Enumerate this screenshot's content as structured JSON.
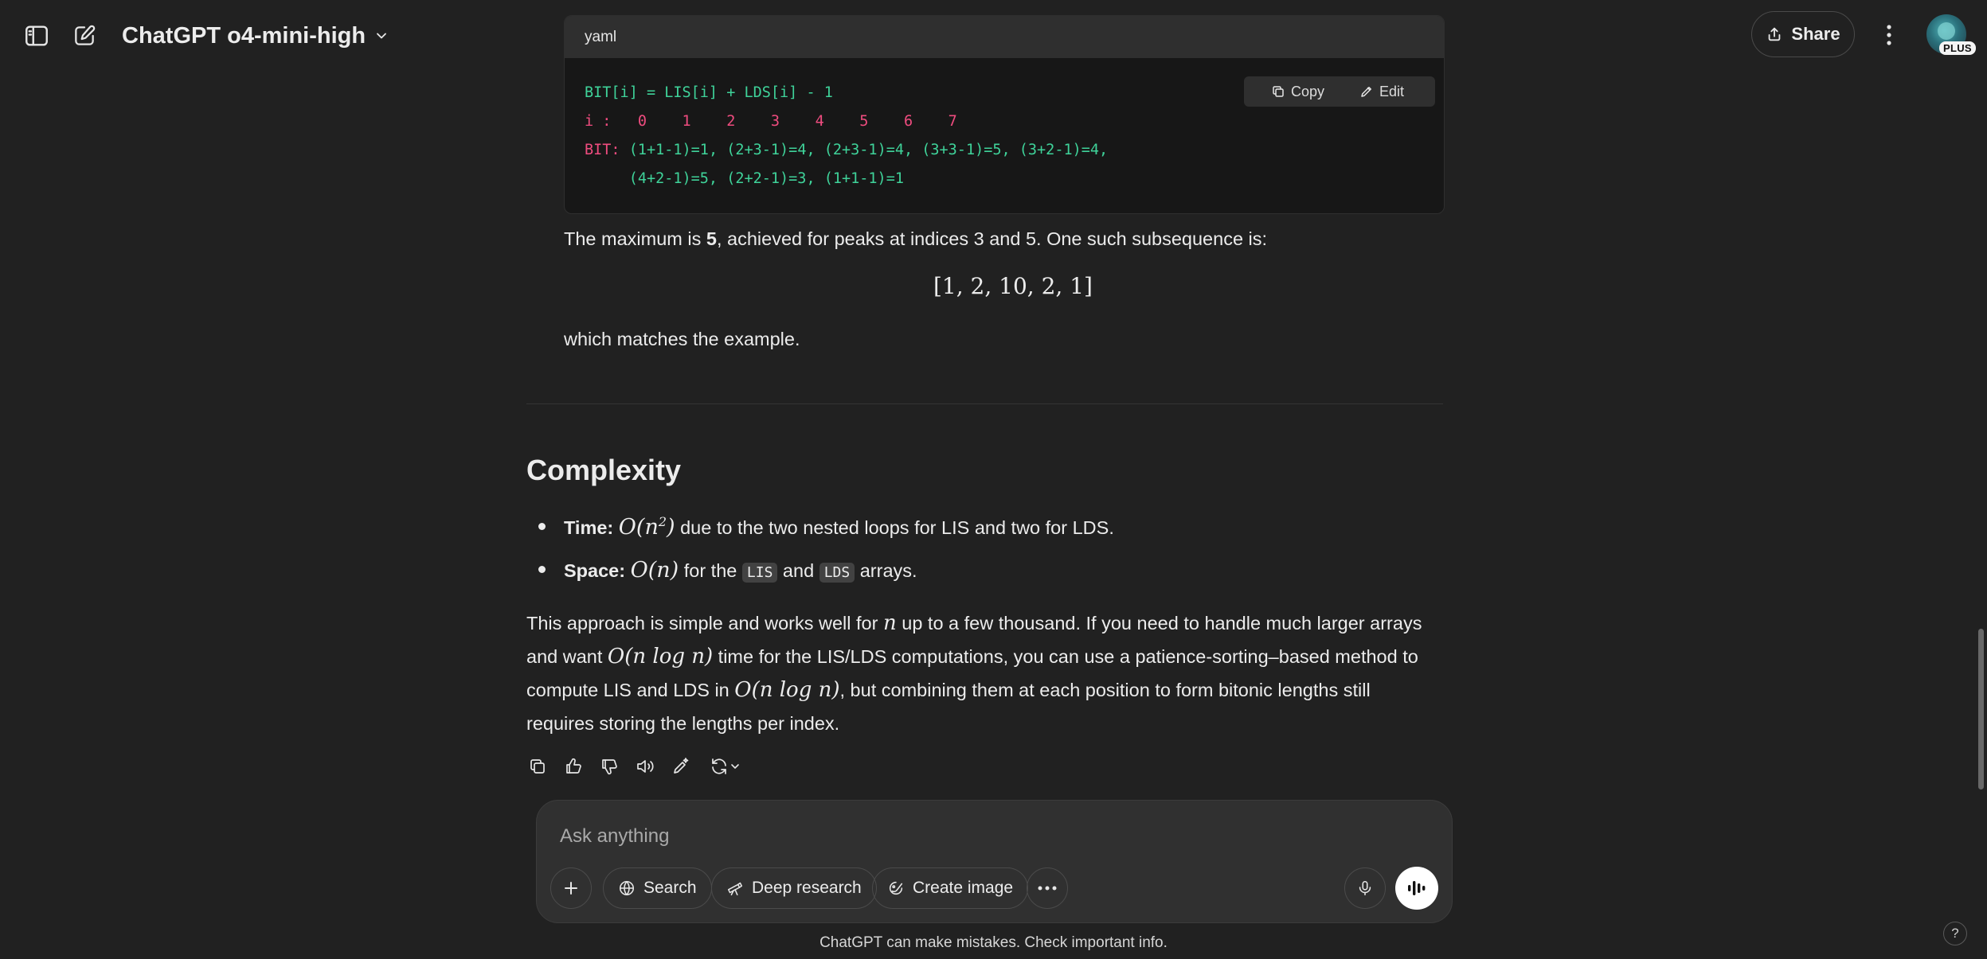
{
  "header": {
    "model_title": "ChatGPT o4-mini-high",
    "share_label": "Share",
    "plan_badge": "PLUS"
  },
  "code_block": {
    "language": "yaml",
    "copy_label": "Copy",
    "edit_label": "Edit",
    "line1": "BIT[i] = LIS[i] + LDS[i] - 1",
    "line2_key": "i :",
    "line2_vals": "   0    1    2    3    4    5    6    7",
    "line3_key": "BIT:",
    "line3_vals": " (1+1-1)=1, (2+3-1)=4, (2+3-1)=4, (3+3-1)=5, (3+2-1)=4,",
    "line4_vals": "     (4+2-1)=5, (2+2-1)=3, (1+1-1)=1"
  },
  "result": {
    "max_prefix": "The maximum is ",
    "max_value": "5",
    "max_suffix": ", achieved for peaks at indices 3 and 5. One such subsequence is:",
    "subsequence_display": "[1, 2, 10, 2, 1]",
    "closing": "which matches the example."
  },
  "complexity": {
    "heading": "Complexity",
    "time_label": "Time:",
    "time_formula_pre": "O(n",
    "time_formula_exp": "2",
    "time_formula_post": ")",
    "time_text": " due to the two nested loops for LIS and two for LDS.",
    "space_label": "Space:",
    "space_formula": "O(n)",
    "space_text1": " for the ",
    "space_code1": "LIS",
    "space_text2": " and ",
    "space_code2": "LDS",
    "space_text3": " arrays."
  },
  "paragraph": {
    "l1_a": "This approach is simple and works well for ",
    "l1_var": "n",
    "l1_b": " up to a few thousand. If you need to handle much larger arrays",
    "l2_a": "and want ",
    "l2_formula": "O(n log n)",
    "l2_b": " time for the LIS/LDS computations, you can use a patience-sorting–based method to",
    "l3_a": "compute LIS and LDS in ",
    "l3_formula": "O(n log n)",
    "l3_b": ", but combining them at each position to form bitonic lengths still",
    "l4": "requires storing the lengths per index."
  },
  "composer": {
    "placeholder": "Ask anything",
    "search_label": "Search",
    "deep_research_label": "Deep research",
    "create_image_label": "Create image"
  },
  "footer": {
    "disclaimer": "ChatGPT can make mistakes. Check important info.",
    "help": "?"
  },
  "colors": {
    "background": "#212121",
    "code_green": "#3fd39a",
    "code_pink": "#ef4c7f",
    "composer_bg": "#303030"
  }
}
